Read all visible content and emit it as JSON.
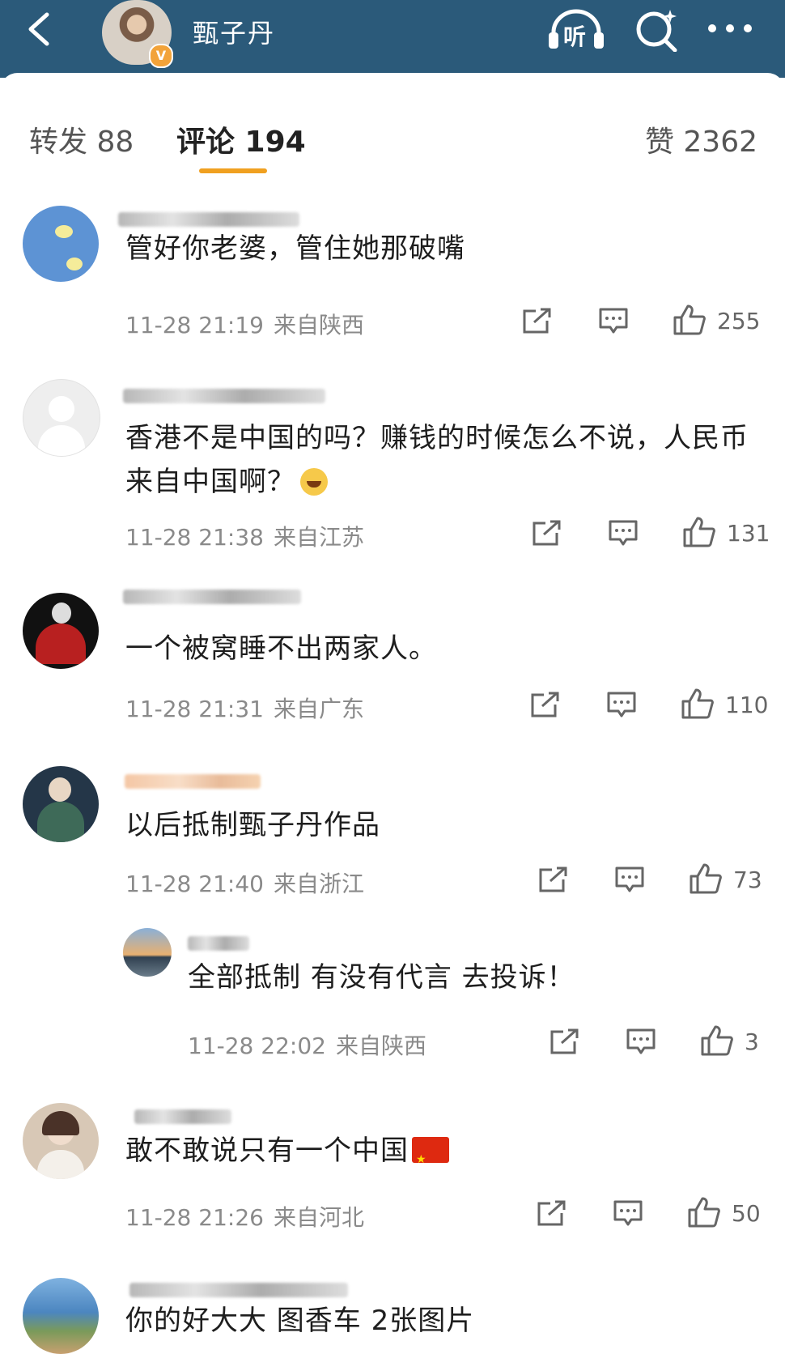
{
  "header": {
    "name": "甄子丹",
    "badge": "V",
    "listen_label": "听"
  },
  "tabs": {
    "repost": "转发 88",
    "comments": "评论 194",
    "likes": "赞 2362"
  },
  "comments": [
    {
      "text": "管好你老婆，管住她那破嘴",
      "time": "11-28 21:19",
      "location": "来自陕西",
      "likes": "255"
    },
    {
      "text": "香港不是中国的吗？赚钱的时候怎么不说，人民币来自中国啊？",
      "time": "11-28 21:38",
      "location": "来自江苏",
      "likes": "131"
    },
    {
      "text": "一个被窝睡不出两家人。",
      "time": "11-28 21:31",
      "location": "来自广东",
      "likes": "110"
    },
    {
      "text": "以后抵制甄子丹作品",
      "time": "11-28 21:40",
      "location": "来自浙江",
      "likes": "73"
    },
    {
      "text": "全部抵制 有没有代言 去投诉！",
      "time": "11-28 22:02",
      "location": "来自陕西",
      "likes": "3"
    },
    {
      "text": "敢不敢说只有一个中国",
      "time": "11-28 21:26",
      "location": "来自河北",
      "likes": "50"
    },
    {
      "text": "你的好大大 图香车 2张图片",
      "time": "",
      "location": "",
      "likes": ""
    }
  ]
}
